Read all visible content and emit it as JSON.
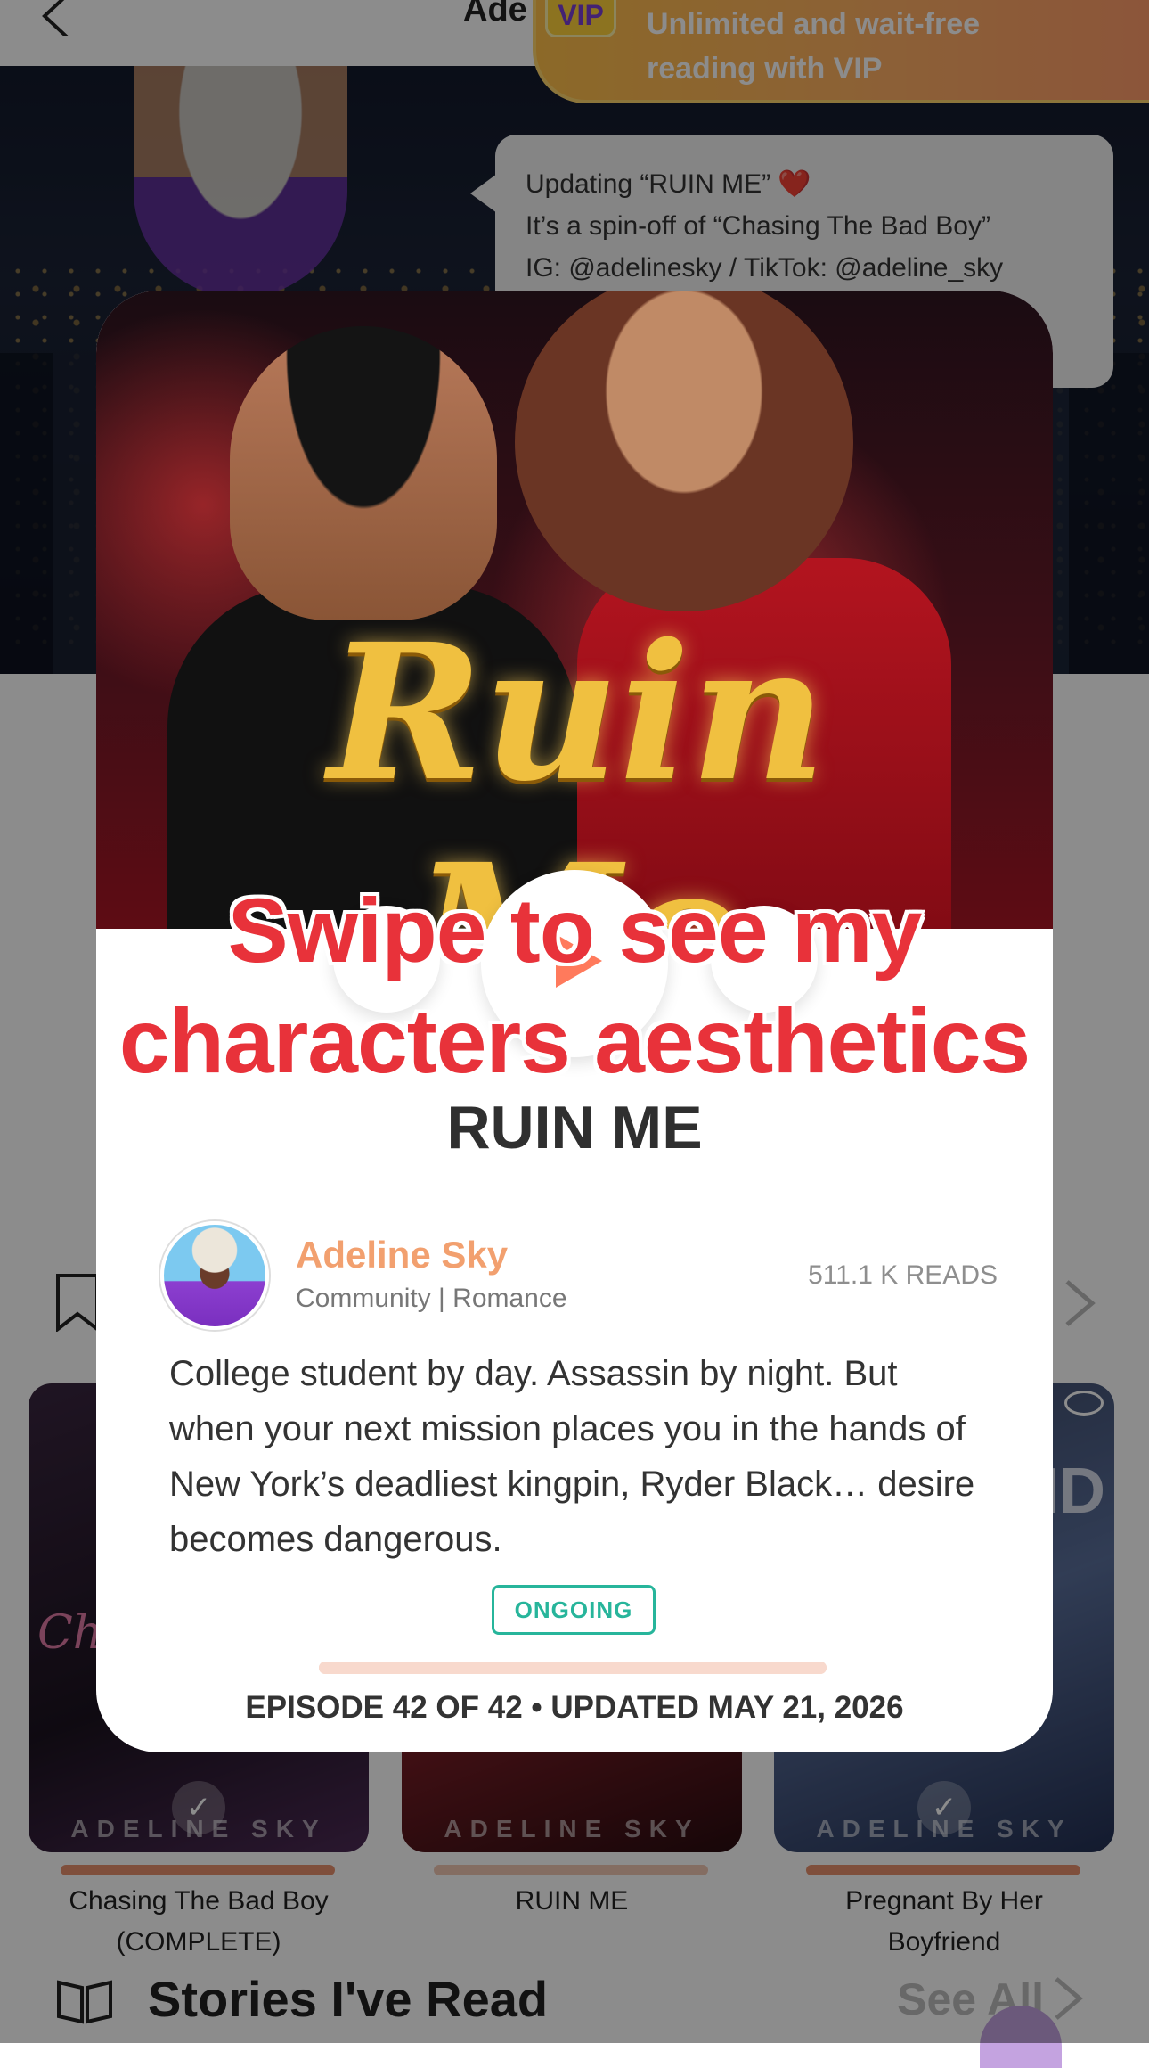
{
  "header": {
    "title": "Ade"
  },
  "vip_banner": {
    "badge": "VIP",
    "line1": "Unlimited and wait-free",
    "line2": "reading with VIP"
  },
  "author_bubble": {
    "line1": "Updating “RUIN ME” ❤️",
    "line2": "It’s a spin-off of “Chasing The Bad Boy”",
    "line3": "IG: @adelinesky / TikTok: @adeline_sky"
  },
  "covers": [
    {
      "title_line1": "Chasing The Bad Boy",
      "title_line2": "(COMPLETE)",
      "watermark": "ADELINE SKY",
      "cover_text": "Cha"
    },
    {
      "title_line1": "RUIN ME",
      "title_line2": "",
      "watermark": "ADELINE SKY"
    },
    {
      "title_line1": "Pregnant By Her",
      "title_line2": "Boyfriend",
      "watermark": "ADELINE SKY",
      "cover_text": "ID"
    }
  ],
  "stories_read": {
    "title": "Stories I've Read",
    "see_all": "See All"
  },
  "modal": {
    "cover_logo": "Ruin Me",
    "swipe_caption_line1": "Swipe to see my",
    "swipe_caption_line2": "characters aesthetics",
    "title": "RUIN ME",
    "author_name": "Adeline Sky",
    "author_meta": "Community | Romance",
    "reads": "511.1 K READS",
    "synopsis": "College student by day. Assassin by night. But when your next mission places you in the hands of New York’s deadliest kingpin, Ryder Black… desire becomes dangerous.",
    "status": "ONGOING",
    "episode_progress": 1.0,
    "episode_info": "EPISODE 42 OF 42 • UPDATED MAY 21, 2026"
  },
  "colors": {
    "accent_red": "#e8323a",
    "author_orange": "#f2a06f",
    "status_green": "#27b59b",
    "vip_gradient_start": "#ffc04a",
    "vip_gradient_end": "#ff9a6b"
  },
  "icons": [
    "back-arrow-icon",
    "bookmark-icon",
    "chevron-right-icon",
    "play-icon",
    "check-icon",
    "eye-icon",
    "book-icon"
  ]
}
